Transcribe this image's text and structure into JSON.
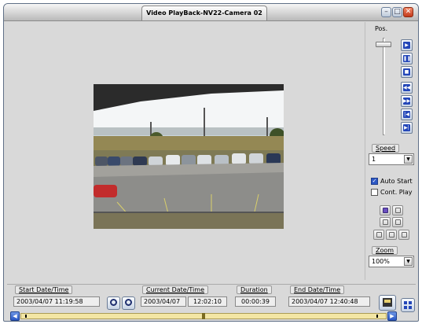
{
  "window": {
    "title": "Video PlayBack-NV22-Camera 02"
  },
  "icons": {
    "minimize": "minimize-icon",
    "maximize": "maximize-icon",
    "close": "close-icon",
    "play": "play-icon",
    "pause": "pause-icon",
    "stop": "stop-icon",
    "rewind": "rewind-icon",
    "fast_forward": "fast-forward-icon",
    "prev": "skip-previous-icon",
    "next": "skip-next-icon",
    "zoom_in": "zoom-in-icon",
    "zoom_out": "zoom-out-icon"
  },
  "glyphs": {
    "minimize": "–",
    "maximize": "□",
    "close": "✕",
    "dropdown": "▼",
    "check": "✓",
    "left": "◀",
    "right": "▶"
  },
  "position": {
    "label": "Pos."
  },
  "speed": {
    "label": "Speed",
    "value": "1"
  },
  "options": {
    "auto_start": {
      "label": "Auto Start",
      "checked": true
    },
    "cont_play": {
      "label": "Cont. Play",
      "checked": false
    }
  },
  "zoom": {
    "label": "Zoom",
    "value": "100%"
  },
  "bottom": {
    "start": {
      "label": "Start Date/Time",
      "value": "2003/04/07 11:19:58"
    },
    "current": {
      "label": "Current Date/Time",
      "date": "2003/04/07",
      "time": "12:02:10"
    },
    "duration": {
      "label": "Duration",
      "value": "00:00:39"
    },
    "end": {
      "label": "End Date/Time",
      "value": "2003/04/07 12:40:48"
    }
  },
  "colors": {
    "accent": "#2346b8",
    "timeline": "#f3e6a4",
    "window_bg": "#d9d9d9"
  }
}
